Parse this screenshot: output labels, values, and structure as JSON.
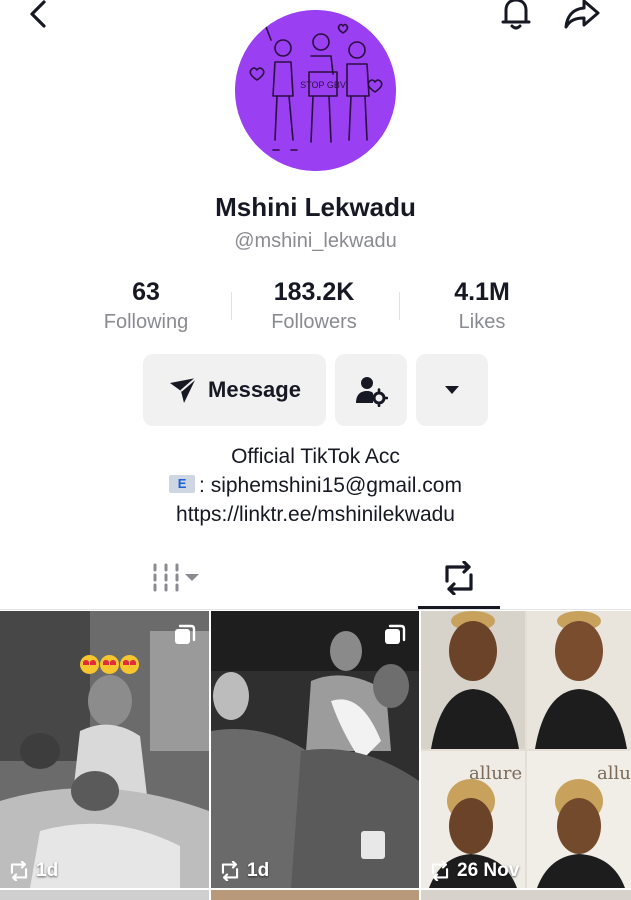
{
  "profile": {
    "name": "Mshini Lekwadu",
    "handle": "@mshini_lekwadu",
    "avatar_caption": "STOP GBV"
  },
  "stats": [
    {
      "value": "63",
      "label": "Following"
    },
    {
      "value": "183.2K",
      "label": "Followers"
    },
    {
      "value": "4.1M",
      "label": "Likes"
    }
  ],
  "actions": {
    "message_label": "Message"
  },
  "bio": {
    "line1": "Official TikTok Acc",
    "line2": ": siphemshini15@gmail.com",
    "line3": "https://linktr.ee/mshinilekwadu",
    "mail_emoji": "E"
  },
  "tabs": {
    "active": "reposts"
  },
  "videos": [
    {
      "time": "1d",
      "multi": true
    },
    {
      "time": "1d",
      "multi": true
    },
    {
      "time": "26 Nov",
      "multi": false,
      "overlay_text_1": "allure",
      "overlay_text_2": "allu"
    }
  ],
  "colors": {
    "text": "#161823",
    "muted": "#8a8b91",
    "button_bg": "#f1f1f2",
    "avatar_bg": "#9a3ff2"
  }
}
